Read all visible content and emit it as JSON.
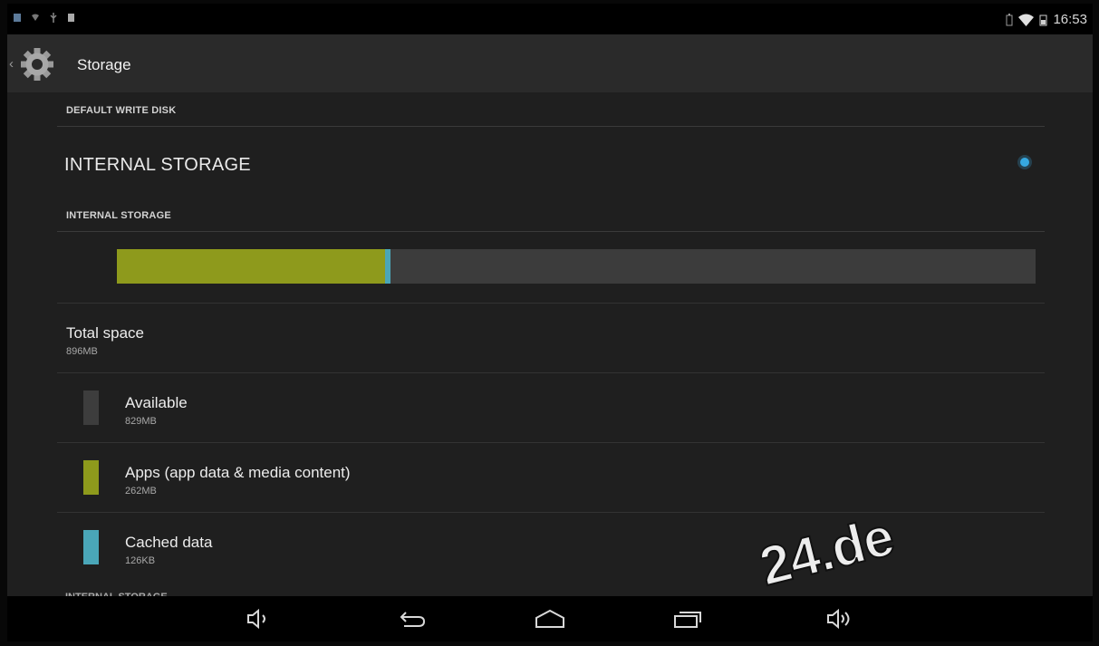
{
  "status_bar": {
    "time": "16:53",
    "left_icons": [
      "screenshot-icon",
      "wifi-icon",
      "usb-icon",
      "sd-card-icon"
    ],
    "right_icons": [
      "battery-icon",
      "wifi-signal-icon"
    ]
  },
  "action_bar": {
    "title": "Storage",
    "icon": "gear-icon"
  },
  "default_write_disk": {
    "header": "DEFAULT WRITE DISK",
    "option_label": "INTERNAL STORAGE",
    "selected": true
  },
  "internal_storage": {
    "header": "INTERNAL STORAGE",
    "usage_bar": {
      "apps_fraction": 0.292,
      "cache_fraction": 0.006
    },
    "total": {
      "label": "Total space",
      "value": "896MB"
    },
    "items": [
      {
        "label": "Available",
        "value": "829MB",
        "color": "#3d3d3d"
      },
      {
        "label": "Apps (app data & media content)",
        "value": "262MB",
        "color": "#8e9a1c"
      },
      {
        "label": "Cached data",
        "value": "126KB",
        "color": "#4aa6b8"
      }
    ],
    "next_header": "INTERNAL STORAGE"
  },
  "nav_bar": {
    "buttons": [
      "volume-down-icon",
      "back-icon",
      "home-icon",
      "recents-icon",
      "volume-up-icon"
    ]
  },
  "watermark": "24.de",
  "colors": {
    "accent": "#36a8e0",
    "apps": "#8e9a1c",
    "cache": "#4aa6b8",
    "background": "#1f1f1f"
  }
}
